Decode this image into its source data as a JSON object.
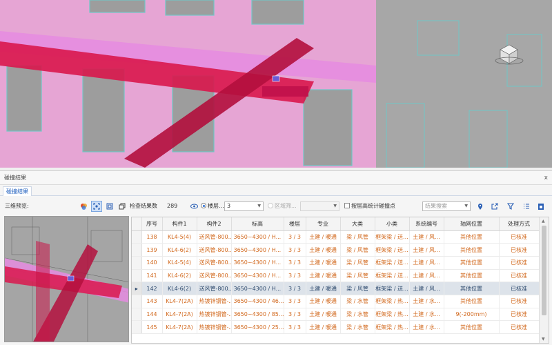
{
  "panel": {
    "title": "碰撞结果",
    "close": "x"
  },
  "tab": "碰撞结果",
  "toolbar": {
    "preview_label": "三维预览:",
    "count_label": "检查结果数",
    "count_value": "289",
    "floor_radio": "楼层...",
    "floor_value": "3",
    "region_radio": "区域筛...",
    "stats_checkbox": "按层高统计碰撞点",
    "search_placeholder": "结果搜索"
  },
  "columns": [
    "序号",
    "构件1",
    "构件2",
    "标高",
    "楼层",
    "专业",
    "大类",
    "小类",
    "系统编号",
    "轴网位置",
    "处理方式"
  ],
  "rows": [
    [
      "138",
      "KL4-5(4)",
      "送风管-800...",
      "3650~4300 / H...",
      "3 / 3",
      "土建 / 暖通",
      "梁 / 风管",
      "框架梁 / 送...",
      "土建 / 风...",
      "其他位置",
      "已核准"
    ],
    [
      "139",
      "KL4-6(2)",
      "送风管-800...",
      "3650~4300 / H...",
      "3 / 3",
      "土建 / 暖通",
      "梁 / 风管",
      "框架梁 / 送...",
      "土建 / 风...",
      "其他位置",
      "已核准"
    ],
    [
      "140",
      "KL4-5(4)",
      "送风管-800...",
      "3650~4300 / H...",
      "3 / 3",
      "土建 / 暖通",
      "梁 / 风管",
      "框架梁 / 送...",
      "土建 / 风...",
      "其他位置",
      "已核准"
    ],
    [
      "141",
      "KL4-6(2)",
      "送风管-800...",
      "3650~4300 / H...",
      "3 / 3",
      "土建 / 暖通",
      "梁 / 风管",
      "框架梁 / 送...",
      "土建 / 风...",
      "其他位置",
      "已核准"
    ],
    [
      "142",
      "KL4-6(2)",
      "送风管-800...",
      "3650~4300 / H...",
      "3 / 3",
      "土建 / 暖通",
      "梁 / 风管",
      "框架梁 / 送...",
      "土建 / 风...",
      "其他位置",
      "已核准"
    ],
    [
      "143",
      "KL4-7(2A)",
      "热镀锌钢管-...",
      "3650~4300 / 46...",
      "3 / 3",
      "土建 / 暖通",
      "梁 / 水管",
      "框架梁 / 热...",
      "土建 / 水...",
      "其他位置",
      "已核准"
    ],
    [
      "144",
      "KL4-7(2A)",
      "热镀锌钢管-...",
      "3650~4300 / 85...",
      "3 / 3",
      "土建 / 暖通",
      "梁 / 水管",
      "框架梁 / 热...",
      "土建 / 水...",
      "9(-200mm)",
      "已核准"
    ],
    [
      "145",
      "KL4-7(2A)",
      "热镀锌钢管-...",
      "3650~4300 / 25...",
      "3 / 3",
      "土建 / 暖通",
      "梁 / 水管",
      "框架梁 / 热...",
      "土建 / 水...",
      "其他位置",
      "已核准"
    ]
  ],
  "selected_row": "142",
  "icons": [
    "color-icon",
    "fit-view-icon",
    "snapshot-icon",
    "copy-icon",
    "eye-icon",
    "location-icon",
    "export-icon",
    "filter-icon",
    "list-icon",
    "excel-icon"
  ]
}
